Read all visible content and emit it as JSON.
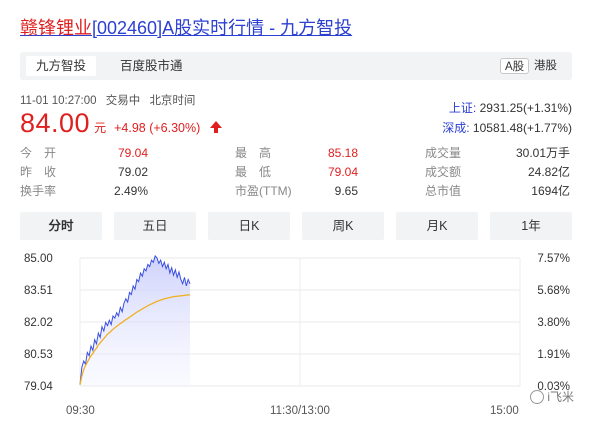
{
  "header": {
    "name": "赣锋锂业",
    "code": "[002460]",
    "rest": "A股实时行情 - 九方智投"
  },
  "tabs": {
    "jiufang": "九方智投",
    "baidu": "百度股市通",
    "a_share": "A股",
    "hk": "港股"
  },
  "status": {
    "datetime": "11-01 10:27:00",
    "state": "交易中",
    "tz": "北京时间"
  },
  "quote": {
    "price": "84.00",
    "unit": "元",
    "change": "+4.98 (+6.30%)"
  },
  "indices": [
    {
      "name": "上证:",
      "value": "2931.25(+1.31%)"
    },
    {
      "name": "深成:",
      "value": "10581.48(+1.77%)"
    }
  ],
  "stats": [
    [
      {
        "label": "今　开",
        "value": "79.04",
        "red": true
      },
      {
        "label": "最　高",
        "value": "85.18",
        "red": true
      },
      {
        "label": "成交量",
        "value": "30.01万手",
        "red": false
      }
    ],
    [
      {
        "label": "昨　收",
        "value": "79.02",
        "red": false
      },
      {
        "label": "最　低",
        "value": "79.04",
        "red": true
      },
      {
        "label": "成交额",
        "value": "24.82亿",
        "red": false
      }
    ],
    [
      {
        "label": "换手率",
        "value": "2.49%",
        "red": false
      },
      {
        "label": "市盈(TTM)",
        "value": "9.65",
        "red": false
      },
      {
        "label": "总市值",
        "value": "1694亿",
        "red": false
      }
    ]
  ],
  "periods": [
    "分时",
    "五日",
    "日K",
    "周K",
    "月K",
    "1年"
  ],
  "active_period": "分时",
  "watermark": "i飞米",
  "colors": {
    "up": "#e02020",
    "link": "#2b3fd1",
    "price_line": "#3b4fe0",
    "avg_line": "#f0b020"
  },
  "chart_data": {
    "type": "line",
    "ylim": [
      79.04,
      85.0
    ],
    "yticks_left": [
      "85.00",
      "83.51",
      "82.02",
      "80.53",
      "79.04"
    ],
    "yticks_right": [
      "7.57%",
      "5.68%",
      "3.80%",
      "1.91%",
      "0.03%"
    ],
    "xticks": [
      "09:30",
      "11:30/13:00",
      "15:00"
    ],
    "total_minutes": 240,
    "series": [
      {
        "role": "price",
        "values": [
          79.1,
          79.9,
          80.2,
          80.05,
          80.6,
          80.45,
          80.9,
          80.7,
          81.2,
          81.0,
          81.5,
          81.3,
          81.8,
          81.6,
          82.0,
          81.85,
          82.1,
          81.9,
          82.3,
          82.2,
          82.45,
          82.3,
          82.7,
          82.5,
          82.9,
          83.1,
          82.95,
          83.4,
          83.3,
          83.7,
          83.55,
          84.0,
          83.9,
          84.3,
          84.15,
          84.5,
          84.4,
          84.7,
          84.6,
          84.9,
          84.8,
          85.1,
          85.0,
          84.75,
          84.9,
          84.6,
          84.8,
          84.5,
          84.7,
          84.3,
          84.55,
          84.2,
          84.45,
          84.1,
          84.35,
          84.0,
          83.8,
          84.1,
          83.7,
          84.0,
          83.8
        ]
      },
      {
        "role": "average",
        "values": [
          79.1,
          79.5,
          79.8,
          80.0,
          80.15,
          80.3,
          80.45,
          80.55,
          80.7,
          80.8,
          80.95,
          81.05,
          81.15,
          81.25,
          81.35,
          81.45,
          81.52,
          81.6,
          81.68,
          81.75,
          81.82,
          81.88,
          81.95,
          82.0,
          82.07,
          82.13,
          82.18,
          82.24,
          82.3,
          82.36,
          82.42,
          82.48,
          82.53,
          82.58,
          82.63,
          82.68,
          82.73,
          82.78,
          82.82,
          82.86,
          82.9,
          82.94,
          82.98,
          83.01,
          83.04,
          83.07,
          83.1,
          83.12,
          83.14,
          83.16,
          83.18,
          83.2,
          83.21,
          83.22,
          83.23,
          83.24,
          83.25,
          83.26,
          83.27,
          83.28,
          83.29
        ]
      }
    ]
  }
}
